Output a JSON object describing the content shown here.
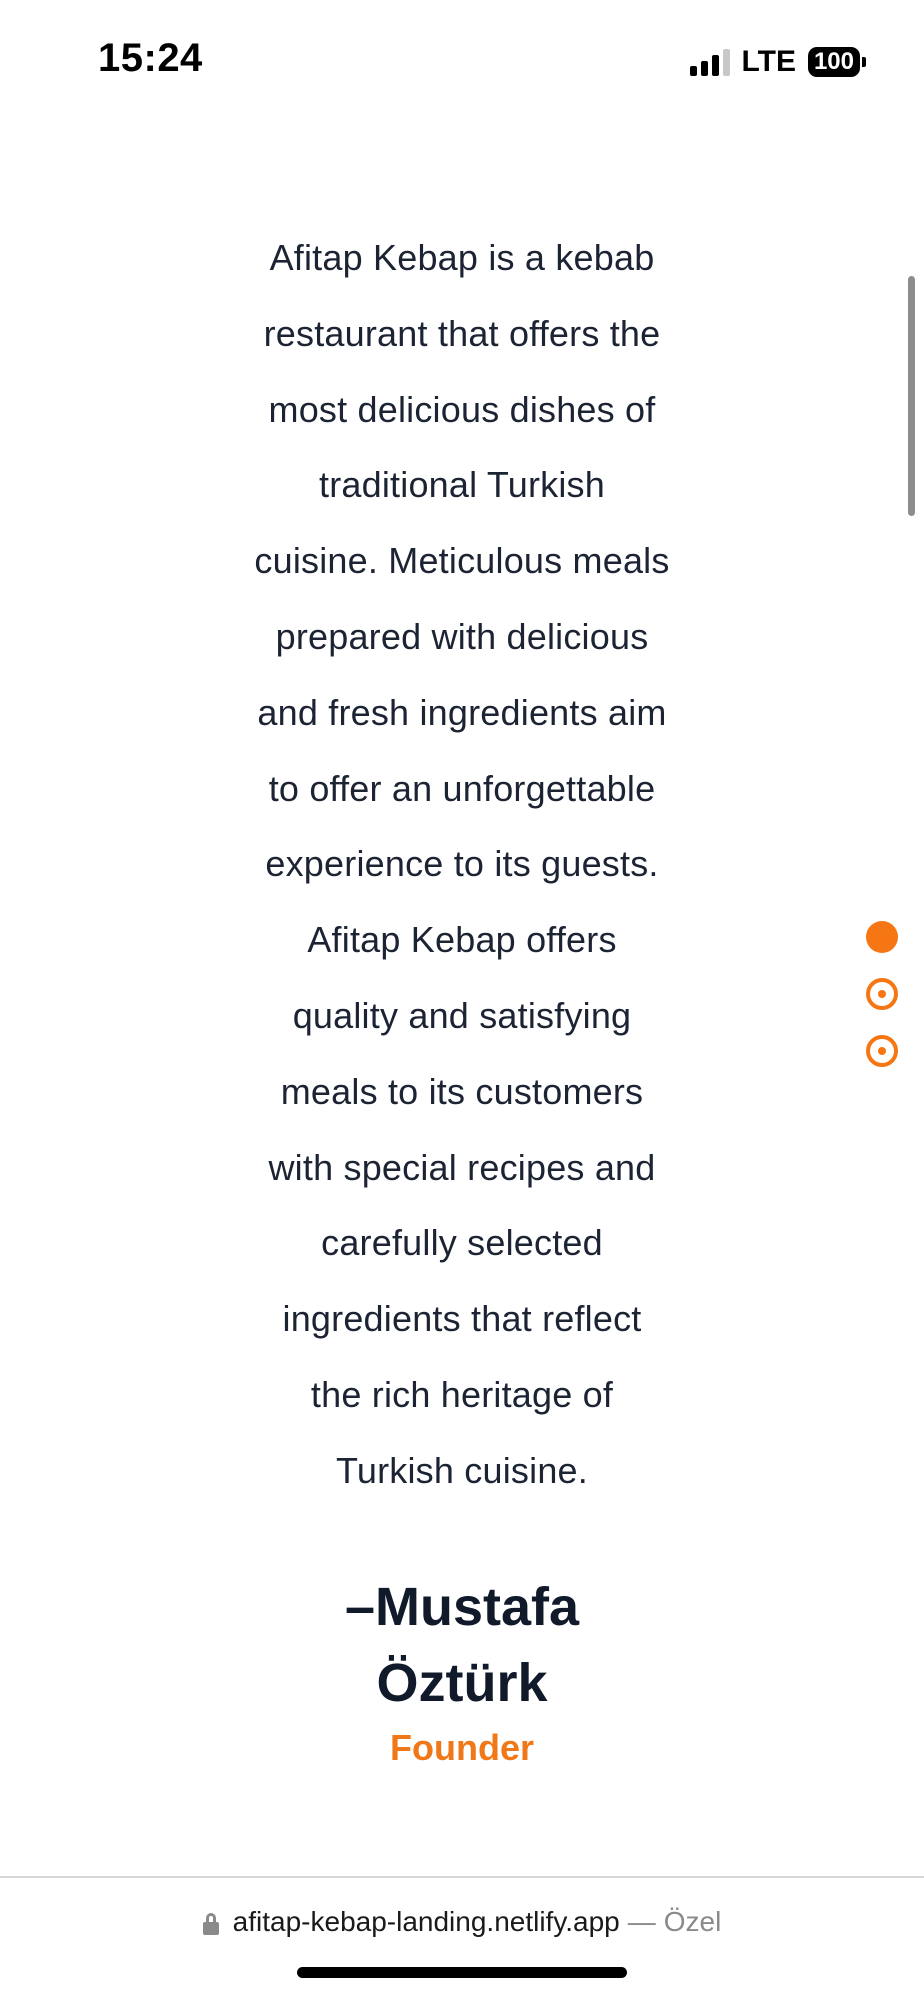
{
  "status_bar": {
    "time": "15:24",
    "network": "LTE",
    "battery": "100"
  },
  "testimonial": {
    "lines": [
      "Afitap Kebap is a kebab",
      "restaurant that offers the",
      "most delicious dishes of",
      "traditional Turkish",
      "cuisine. Meticulous meals",
      "prepared with delicious",
      "and fresh ingredients aim",
      "to offer an unforgettable",
      "experience to its guests.",
      "Afitap Kebap offers",
      "quality and satisfying",
      "meals to its customers",
      "with special recipes and",
      "carefully selected",
      "ingredients that reflect",
      "the rich heritage of",
      "Turkish cuisine."
    ],
    "author_line1": "–Mustafa",
    "author_line2": "Öztürk",
    "role": "Founder"
  },
  "pagination": {
    "total": 3,
    "active_index": 0,
    "color": "#f57612"
  },
  "browser": {
    "domain": "afitap-kebap-landing.netlify.app",
    "separator": "—",
    "mode": "Özel"
  },
  "colors": {
    "accent": "#f57612",
    "text": "#1c2434",
    "heading": "#101a2b"
  }
}
